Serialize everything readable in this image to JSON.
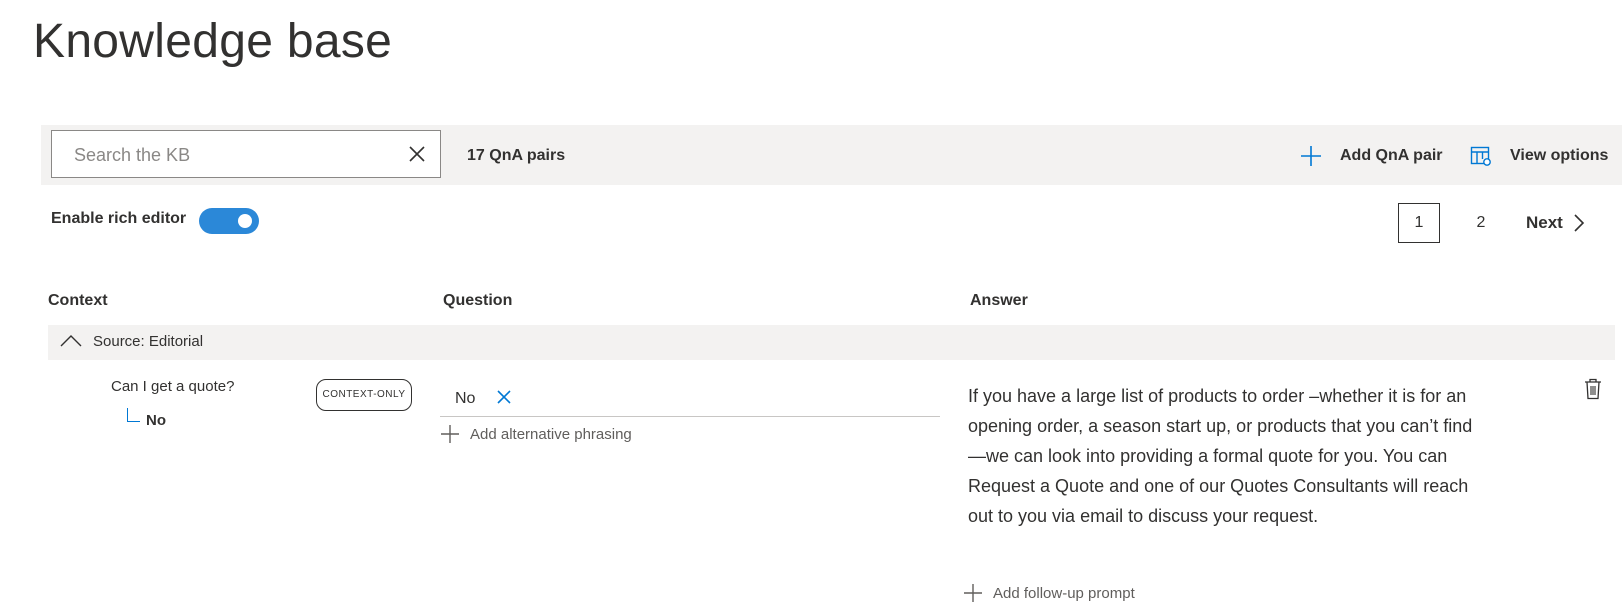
{
  "page": {
    "title": "Knowledge base"
  },
  "toolbar": {
    "search_placeholder": "Search the KB",
    "search_value": "",
    "count_label": "17 QnA pairs",
    "add_label": "Add QnA pair",
    "view_label": "View options"
  },
  "editor": {
    "rich_label": "Enable rich editor",
    "rich_enabled": true
  },
  "pagination": {
    "pages": [
      "1",
      "2"
    ],
    "current": "1",
    "next_label": "Next"
  },
  "columns": {
    "context": "Context",
    "question": "Question",
    "answer": "Answer"
  },
  "group": {
    "label": "Source: Editorial"
  },
  "row": {
    "context_question": "Can I get a quote?",
    "context_badge": "CONTEXT-ONLY",
    "context_answer": "No",
    "question": "No",
    "add_alternative": "Add alternative phrasing",
    "answer": "If you have a large list of products to order –whether it is for an opening order, a season start up, or products that you can’t find—we can look into providing a formal quote for you. You can Request a Quote and one of our Quotes Consultants will reach out to you via email to discuss your request.",
    "add_follow_up": "Add follow-up prompt"
  },
  "colors": {
    "accent": "#0078d4",
    "toggle_on": "#2b88d8",
    "toolbar_bg": "#f3f2f1",
    "text": "#323130"
  },
  "icons": {
    "search_clear": "close-icon",
    "add": "plus-icon",
    "view": "view-options-icon",
    "next": "chevron-right-icon",
    "group_toggle": "chevron-up-icon",
    "delete": "trash-icon"
  }
}
